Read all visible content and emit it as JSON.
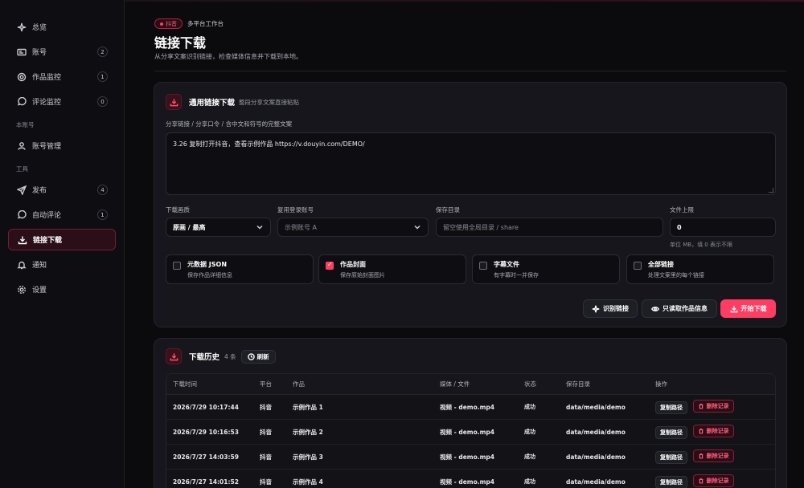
{
  "sidebar": {
    "items": [
      {
        "label": "总览",
        "icon": "sparkle-icon"
      },
      {
        "label": "账号",
        "icon": "id-card-icon",
        "count": "2"
      },
      {
        "label": "作品监控",
        "icon": "target-icon",
        "count": "1"
      },
      {
        "label": "评论监控",
        "icon": "chat-bubble-icon",
        "count": "0"
      }
    ],
    "group1": "本账号",
    "group1_items": [
      {
        "label": "账号管理",
        "icon": "user-icon"
      }
    ],
    "group2": "工具",
    "group2_items": [
      {
        "label": "发布",
        "icon": "send-icon",
        "count": "4"
      },
      {
        "label": "自动评论",
        "icon": "chat-bubble-icon",
        "count": "1"
      },
      {
        "label": "链接下载",
        "icon": "download-icon",
        "active": true
      },
      {
        "label": "通知",
        "icon": "bell-icon"
      },
      {
        "label": "设置",
        "icon": "gear-icon"
      }
    ]
  },
  "header": {
    "badge": "抖音",
    "badge_sub": "多平台工作台",
    "title": "链接下载",
    "subtitle": "从分享文案识别链接，检查媒体信息并下载到本地。"
  },
  "download": {
    "title": "通用链接下载",
    "hint": "整段分享文案直接粘贴",
    "input_label": "分享链接 / 分享口令 / 含中文和符号的完整文案",
    "input_value": "3.26 复制打开抖音，查看示例作品 https://v.douyin.com/DEMO/",
    "quality_label": "下载画质",
    "quality_value": "原画 / 最高",
    "account_label": "复用登录账号",
    "account_value": "示例账号 A",
    "dir_label": "保存目录",
    "dir_placeholder": "留空使用全局目录 / share",
    "limit_label": "文件上限",
    "limit_value": "0",
    "limit_hint": "单位 MB，填 0 表示不限",
    "options": [
      {
        "title": "元数据 JSON",
        "sub": "保存作品详细信息",
        "checked": false
      },
      {
        "title": "作品封面",
        "sub": "保存原始封面图片",
        "checked": true
      },
      {
        "title": "字幕文件",
        "sub": "有字幕时一并保存",
        "checked": false
      },
      {
        "title": "全部链接",
        "sub": "处理文案里的每个链接",
        "checked": false
      }
    ],
    "btn_parse": "识别链接",
    "btn_info": "只读取作品信息",
    "btn_start": "开始下载"
  },
  "history": {
    "title": "下载历史",
    "count": "4 条",
    "refresh": "刷新",
    "columns": [
      "下载时间",
      "平台",
      "作品",
      "媒体 / 文件",
      "状态",
      "保存目录",
      "操作"
    ],
    "rows": [
      {
        "time": "2026/7/29 10:17:44",
        "platform": "抖音",
        "work": "示例作品 1",
        "media": "视频 - demo.mp4",
        "status": "成功",
        "dir": "data/media/demo"
      },
      {
        "time": "2026/7/29 10:16:53",
        "platform": "抖音",
        "work": "示例作品 2",
        "media": "视频 - demo.mp4",
        "status": "成功",
        "dir": "data/media/demo"
      },
      {
        "time": "2026/7/27 14:03:59",
        "platform": "抖音",
        "work": "示例作品 3",
        "media": "视频 - demo.mp4",
        "status": "成功",
        "dir": "data/media/demo"
      },
      {
        "time": "2026/7/27 14:01:52",
        "platform": "抖音",
        "work": "示例作品 4",
        "media": "视频 - demo.mp4",
        "status": "成功",
        "dir": "data/media/demo"
      }
    ],
    "copy_label": "复制路径",
    "delete_label": "删除记录"
  },
  "colors": {
    "accent": "#ff3d63",
    "background": "#0b0b0e",
    "card": "#16161c"
  }
}
